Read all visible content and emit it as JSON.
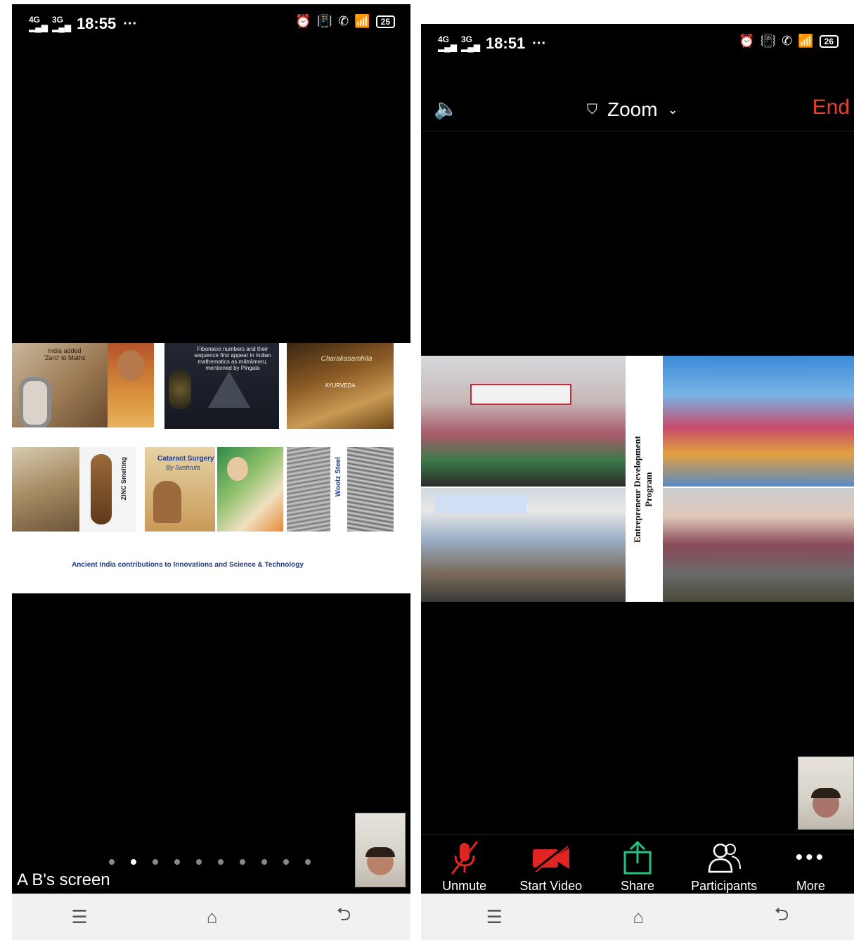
{
  "left": {
    "status": {
      "net1": "4G",
      "net2": "3G",
      "time": "18:55",
      "dots": "···",
      "battery": "25"
    },
    "slide": {
      "tile1_text": "India added 'Zero' to Maths",
      "tile2_text": "Fibonacci numbers and their sequence first appear in Indian mathematics as mātrāmeru, mentioned by Pingala",
      "tile3_title": "Charakasamhita",
      "tile3_sub": "AYURVEDA",
      "zinc_label": "ZINC Smelting",
      "cataract_title": "Cataract Surgery",
      "cataract_sub": "By Sushruta",
      "wootz_label": "Wootz Steel",
      "caption": "Ancient India contributions to Innovations and Science & Technology"
    },
    "screen_label": "A B's screen",
    "pager": {
      "count": 10,
      "active_index": 1
    },
    "nav": {
      "menu": "☰",
      "home": "⌂",
      "back": "⮌"
    }
  },
  "right": {
    "status": {
      "net1": "4G",
      "net2": "3G",
      "time": "18:51",
      "dots": "···",
      "battery": "26"
    },
    "header": {
      "title": "Zoom",
      "end_label": "End"
    },
    "slide": {
      "vertical_title": "Entrepreneur Development Program"
    },
    "toolbar": {
      "unmute": "Unmute",
      "start_video": "Start Video",
      "share": "Share",
      "participants": "Participants",
      "more": "More"
    },
    "nav": {
      "menu": "☰",
      "home": "⌂",
      "back": "⮌"
    },
    "colors": {
      "end": "#e8412f",
      "mute_red": "#e02424",
      "share_green": "#26c281"
    }
  }
}
